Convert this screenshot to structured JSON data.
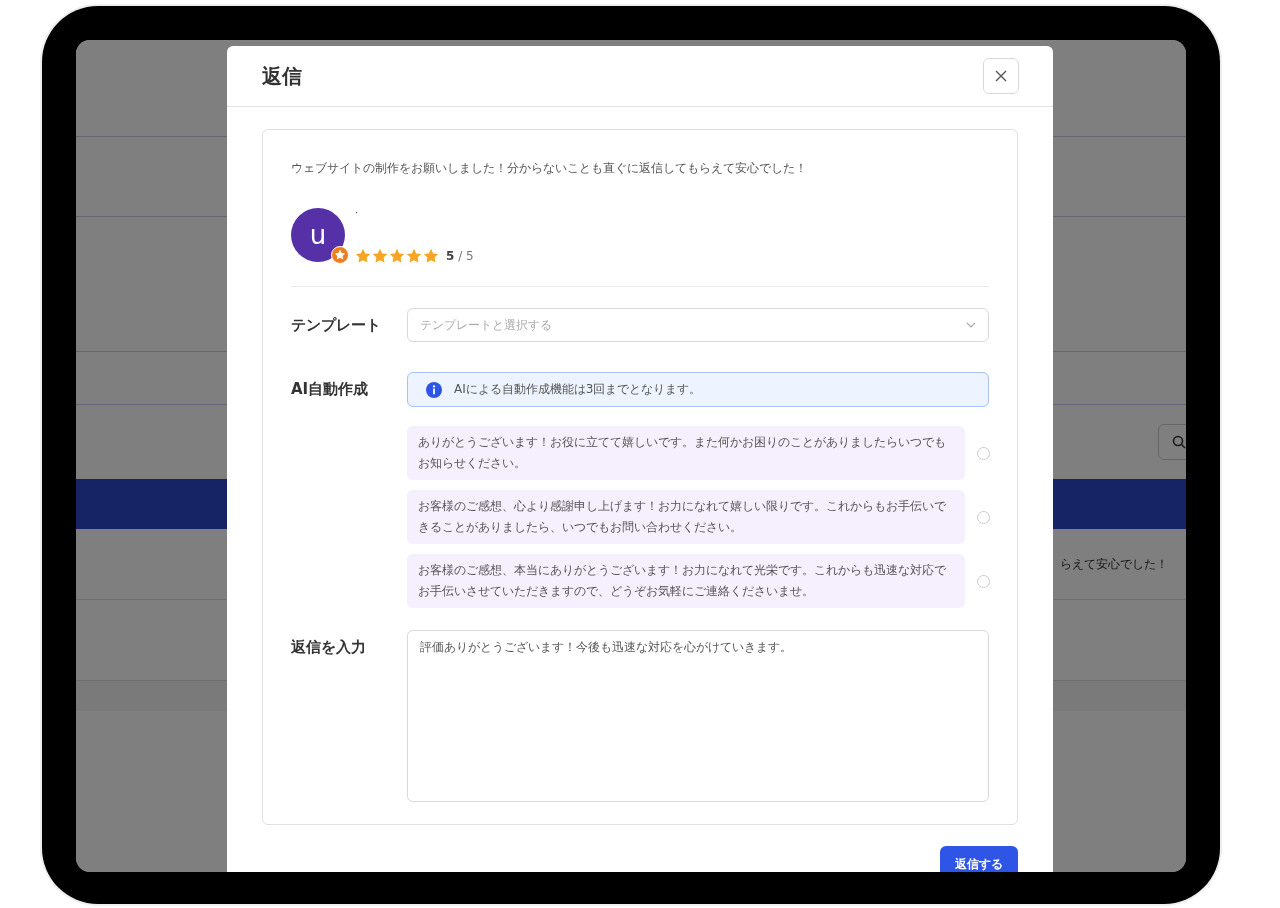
{
  "background": {
    "review_fragment": "らえて安心でした！"
  },
  "dialog": {
    "title": "返信",
    "review": {
      "text": "ウェブサイトの制作をお願いしました！分からないことも直ぐに返信してもらえて安心でした！",
      "avatar_letter": "u",
      "reviewer_name": "·",
      "stars": 5,
      "score": "5",
      "score_max": "/ 5"
    },
    "template": {
      "label": "テンプレート",
      "placeholder": "テンプレートと選択する"
    },
    "ai": {
      "label": "AI自動作成",
      "notice": "AIによる自動作成機能は3回までとなります。",
      "suggestions": [
        {
          "text": "ありがとうございます！お役に立てて嬉しいです。また何かお困りのことがありましたらいつでもお知らせください。",
          "selected": false
        },
        {
          "text": "お客様のご感想、心より感謝申し上げます！お力になれて嬉しい限りです。これからもお手伝いできることがありましたら、いつでもお問い合わせください。",
          "selected": false
        },
        {
          "text": "お客様のご感想、本当にありがとうございます！お力になれて光栄です。これからも迅速な対応でお手伝いさせていただきますので、どうぞお気軽にご連絡くださいませ。",
          "selected": false
        }
      ]
    },
    "reply": {
      "label": "返信を入力",
      "value": "評価ありがとうございます！今後も迅速な対応を心がけていきます。"
    },
    "submit": "返信する"
  }
}
